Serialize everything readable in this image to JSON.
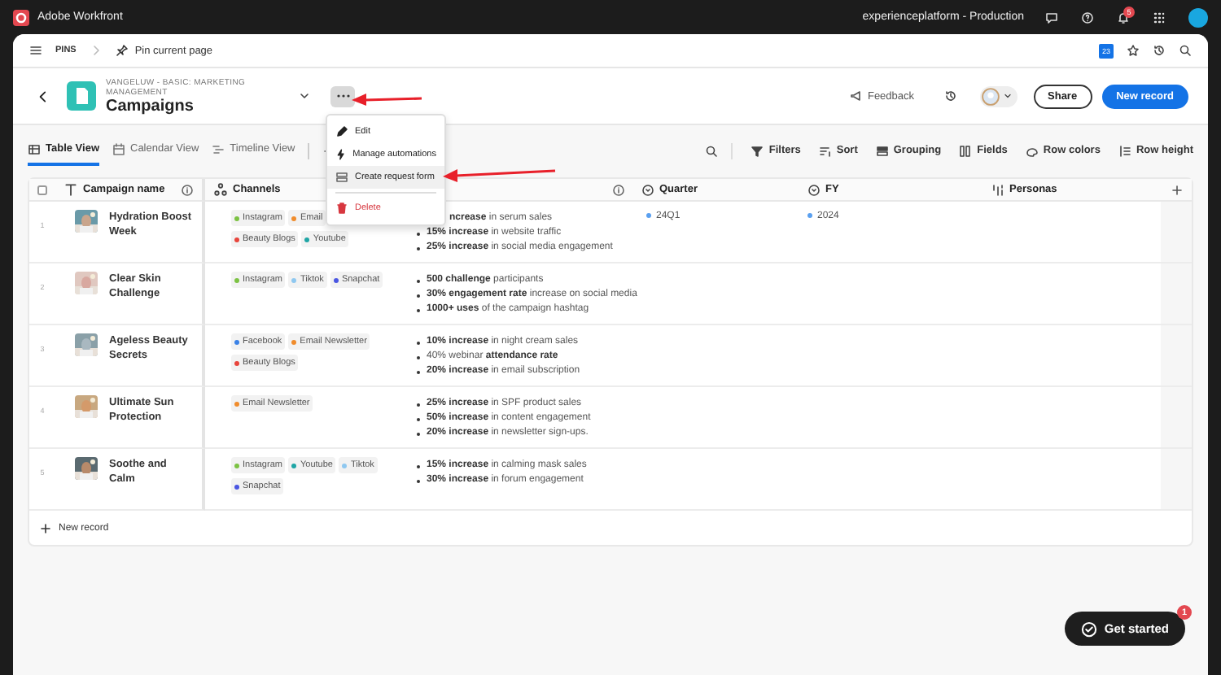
{
  "app_bar": {
    "title": "Adobe Workfront",
    "environment": "experienceplatform - Production",
    "notification_count": "5"
  },
  "pins_bar": {
    "label": "PINS",
    "pin_action": "Pin current page",
    "calendar_day": "23"
  },
  "header": {
    "breadcrumb": "VANGELUW - BASIC: MARKETING MANAGEMENT",
    "title": "Campaigns",
    "feedback": "Feedback",
    "share": "Share",
    "new_record": "New record"
  },
  "views": [
    {
      "label": "Table View",
      "selected": true
    },
    {
      "label": "Calendar View",
      "selected": false
    },
    {
      "label": "Timeline View",
      "selected": false
    }
  ],
  "toolbar": [
    {
      "label": "Filters"
    },
    {
      "label": "Sort"
    },
    {
      "label": "Grouping"
    },
    {
      "label": "Fields"
    },
    {
      "label": "Row colors"
    },
    {
      "label": "Row height"
    }
  ],
  "table": {
    "select_all": {
      "checked": false
    },
    "columns": [
      {
        "label": "Campaign name"
      },
      {
        "label": "Channels"
      },
      {},
      {
        "label": "Quarter"
      },
      {
        "label": "FY"
      },
      {
        "label": "Personas"
      }
    ],
    "rows": [
      {
        "number": "1",
        "name": "Hydration Boost Week",
        "channels": [
          {
            "label": "Instagram",
            "color": "#7cc243"
          },
          {
            "label": "Email",
            "color": "#f08c2c"
          },
          {
            "label": "Beauty Blogs",
            "color": "#e8453c"
          },
          {
            "label": "Youtube",
            "color": "#1fa5a5"
          }
        ],
        "objectives": [
          {
            "text": "**ncrease** in serum sales",
            "covered": true
          },
          {
            "text": "**15% increase** in website traffic",
            "covered": false
          },
          {
            "text": "**25% increase** in social media engagement",
            "covered": false
          }
        ],
        "quarter": "24Q1",
        "fy": "2024"
      },
      {
        "number": "2",
        "name": "Clear Skin Challenge",
        "channels": [
          {
            "label": "Instagram",
            "color": "#7cc243"
          },
          {
            "label": "Tiktok",
            "color": "#8fc8f0"
          },
          {
            "label": "Snapchat",
            "color": "#4a56e2"
          }
        ],
        "objectives": [
          {
            "text": "**500 challenge** participants",
            "covered": false
          },
          {
            "text": "**30% engagement rate** increase on social media",
            "covered": false
          },
          {
            "text": "**1000+ uses** of the campaign hashtag",
            "covered": false
          }
        ]
      },
      {
        "number": "3",
        "name": "Ageless Beauty Secrets",
        "channels": [
          {
            "label": "Facebook",
            "color": "#3b82e6"
          },
          {
            "label": "Email Newsletter",
            "color": "#f08c2c"
          },
          {
            "label": "Beauty Blogs",
            "color": "#e8453c"
          }
        ],
        "objectives": [
          {
            "text": "**10% increase** in night cream sales",
            "covered": false
          },
          {
            "text": "40% webinar **attendance rate**",
            "covered": false
          },
          {
            "text": "**20% increase** in email subscription",
            "covered": false
          }
        ]
      },
      {
        "number": "4",
        "name": "Ultimate Sun Protection",
        "channels": [
          {
            "label": "Email Newsletter",
            "color": "#f08c2c"
          }
        ],
        "objectives": [
          {
            "text": "**25% increase** in SPF product sales",
            "covered": false
          },
          {
            "text": "**50% increase** in content engagement",
            "covered": false
          },
          {
            "text": "**20% increase** in newsletter sign-ups.",
            "covered": false
          }
        ]
      },
      {
        "number": "5",
        "name": "Soothe and Calm",
        "channels": [
          {
            "label": "Instagram",
            "color": "#7cc243"
          },
          {
            "label": "Youtube",
            "color": "#1fa5a5"
          },
          {
            "label": "Tiktok",
            "color": "#8fc8f0"
          },
          {
            "label": "Snapchat",
            "color": "#4a56e2"
          }
        ],
        "objectives": [
          {
            "text": "**15% increase** in calming mask sales",
            "covered": false
          },
          {
            "text": "**30% increase** in forum engagement",
            "covered": false
          }
        ]
      }
    ],
    "new_record": "New record"
  },
  "menu": [
    {
      "label": "Edit",
      "kind": "normal",
      "selected": false
    },
    {
      "label": "Manage automations",
      "kind": "normal",
      "selected": false
    },
    {
      "label": "Create request form",
      "kind": "normal",
      "selected": true
    },
    {
      "label": "Delete",
      "kind": "danger",
      "selected": false
    }
  ],
  "get_started": {
    "label": "Get started",
    "badge": "1"
  }
}
